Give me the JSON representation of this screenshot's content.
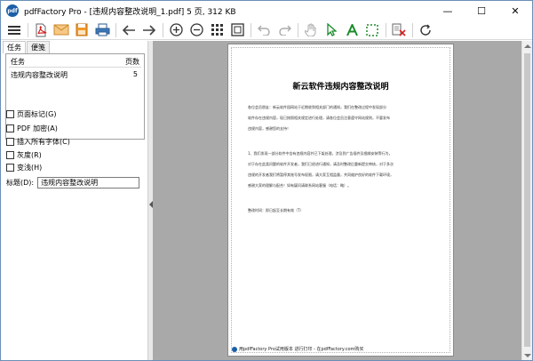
{
  "window": {
    "title": "pdfFactory Pro - [违规内容整改说明_1.pdf] 5 页, 312 KB",
    "app_icon_text": "pdf",
    "minimize": "—",
    "maximize": "☐",
    "close": "✕"
  },
  "tabs": [
    {
      "label": "任务"
    },
    {
      "label": "便笺"
    }
  ],
  "tasks": {
    "col_task": "任务",
    "col_pages": "页数",
    "rows": [
      {
        "name": "违规内容整改说明",
        "pages": "5"
      }
    ]
  },
  "options": [
    {
      "label": "页面标记(G)"
    },
    {
      "label": "PDF 加密(A)"
    },
    {
      "label": "插入所有字体(C)"
    },
    {
      "label": "灰度(R)"
    },
    {
      "label": "变浅(H)"
    }
  ],
  "title_field": {
    "label": "标题(D):",
    "value": "违规内容整改说明"
  },
  "document": {
    "heading": "新云软件违规内容整改说明",
    "lines": [
      "各位会员朋友：新云软件园网站于近期收到相关部门的通知，我们在整改过程中发现部分",
      "软件存在违规内容，现已按照相关规定进行处理，请各位会员注意遵守网站规则，不要发布",
      "违规内容，感谢您的支持！",
      "1、我们发现一部分软件中含有违规内容并已下架处理，涉及到广告插件及捆绑安装等行为，",
      "对于存在此类问题的软件开发者，我们已经进行通知，请及时整改后重新提交审核，对于多次",
      "违规的开发者我们将暂停其账号发布权限，请大家互相监督，共同维护良好的软件下载环境，",
      "感谢大家的理解与配合！如有疑问请联系网站客服（电话：略）。",
      "整改时间：即日起至长期有效（T）"
    ],
    "footer": "用pdfFactory Pro试用版本 进行打印 - 在pdfFactory.com购买"
  }
}
